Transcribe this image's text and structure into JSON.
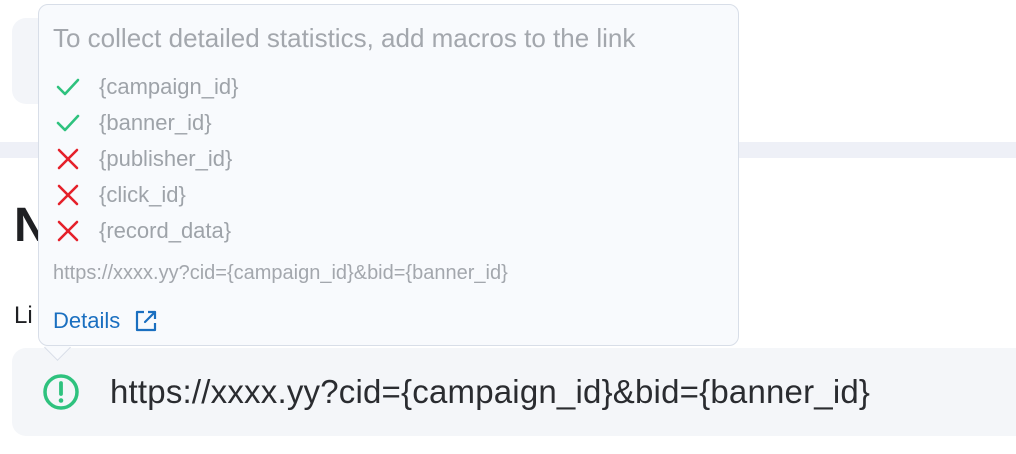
{
  "background": {
    "heading_fragment": "N",
    "label_fragment": "Li"
  },
  "tooltip": {
    "title": "To collect detailed statistics, add macros to the link",
    "macros": [
      {
        "label": "{campaign_id}",
        "status": "present",
        "icon": "check-icon",
        "color": "#2ec27e"
      },
      {
        "label": "{banner_id}",
        "status": "present",
        "icon": "check-icon",
        "color": "#2ec27e"
      },
      {
        "label": "{publisher_id}",
        "status": "missing",
        "icon": "cross-icon",
        "color": "#e5202a"
      },
      {
        "label": "{click_id}",
        "status": "missing",
        "icon": "cross-icon",
        "color": "#e5202a"
      },
      {
        "label": "{record_data}",
        "status": "missing",
        "icon": "cross-icon",
        "color": "#e5202a"
      }
    ],
    "example_link": "https://xxxx.yy?cid={campaign_id}&bid={banner_id}",
    "details_label": "Details",
    "details_icon": "external-link-icon"
  },
  "link_field": {
    "value": "https://xxxx.yy?cid={campaign_id}&bid={banner_id}",
    "status_icon": "warning-circle-icon",
    "status_color": "#2ec27e"
  }
}
